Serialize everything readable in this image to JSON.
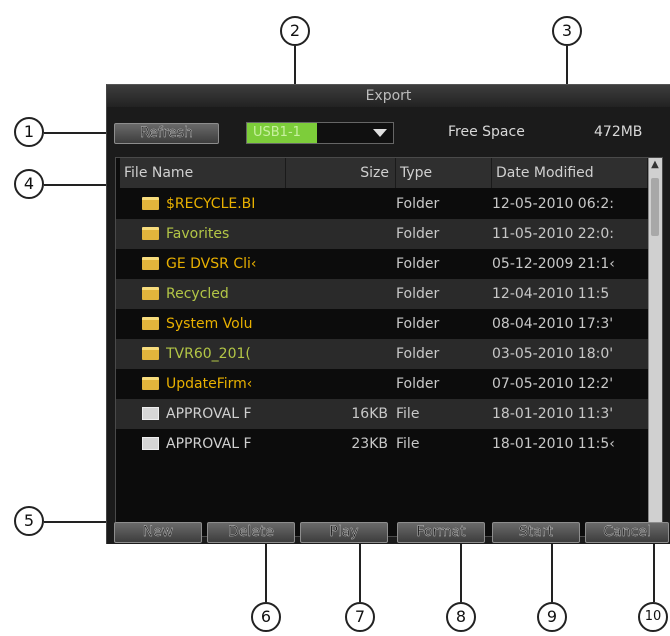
{
  "dialog": {
    "title": "Export",
    "refresh_label": "Refresh",
    "device": "USB1-1",
    "free_space_label": "Free Space",
    "free_space_value": "472MB"
  },
  "columns": [
    "File Name",
    "Size",
    "Type",
    "Date Modified"
  ],
  "rows": [
    {
      "icon": "folder-icon",
      "name": "$RECYCLE.BI",
      "size": "",
      "type": "Folder",
      "date": "12-05-2010 06:2:"
    },
    {
      "icon": "folder-icon",
      "name": "Favorites",
      "size": "",
      "type": "Folder",
      "date": "11-05-2010 22:0:"
    },
    {
      "icon": "folder-icon",
      "name": "GE DVSR Cli‹",
      "size": "",
      "type": "Folder",
      "date": "05-12-2009 21:1‹"
    },
    {
      "icon": "folder-icon",
      "name": "Recycled",
      "size": "",
      "type": "Folder",
      "date": "12-04-2010 11:5"
    },
    {
      "icon": "folder-icon",
      "name": "System Volu",
      "size": "",
      "type": "Folder",
      "date": "08-04-2010 17:3'"
    },
    {
      "icon": "folder-icon",
      "name": "TVR60_201(",
      "size": "",
      "type": "Folder",
      "date": "03-05-2010 18:0'"
    },
    {
      "icon": "folder-icon",
      "name": "UpdateFirm‹",
      "size": "",
      "type": "Folder",
      "date": "07-05-2010 12:2'"
    },
    {
      "icon": "file-icon",
      "name": "APPROVAL F",
      "size": "16KB",
      "type": "File",
      "date": "18-01-2010 11:3'"
    },
    {
      "icon": "file-icon",
      "name": "APPROVAL F",
      "size": "23KB",
      "type": "File",
      "date": "18-01-2010 11:5‹"
    }
  ],
  "buttons": {
    "new": "New",
    "delete": "Delete",
    "play": "Play",
    "format": "Format",
    "start": "Start",
    "cancel": "Cancel"
  },
  "callouts": [
    "1",
    "2",
    "3",
    "4",
    "5",
    "6",
    "7",
    "8",
    "9",
    "10"
  ],
  "colors": {
    "folder_text": "#e8b000",
    "alt_folder_text": "#b3c646",
    "device_highlight": "#7dcd3a",
    "dialog_bg": "#1b1b1b"
  }
}
